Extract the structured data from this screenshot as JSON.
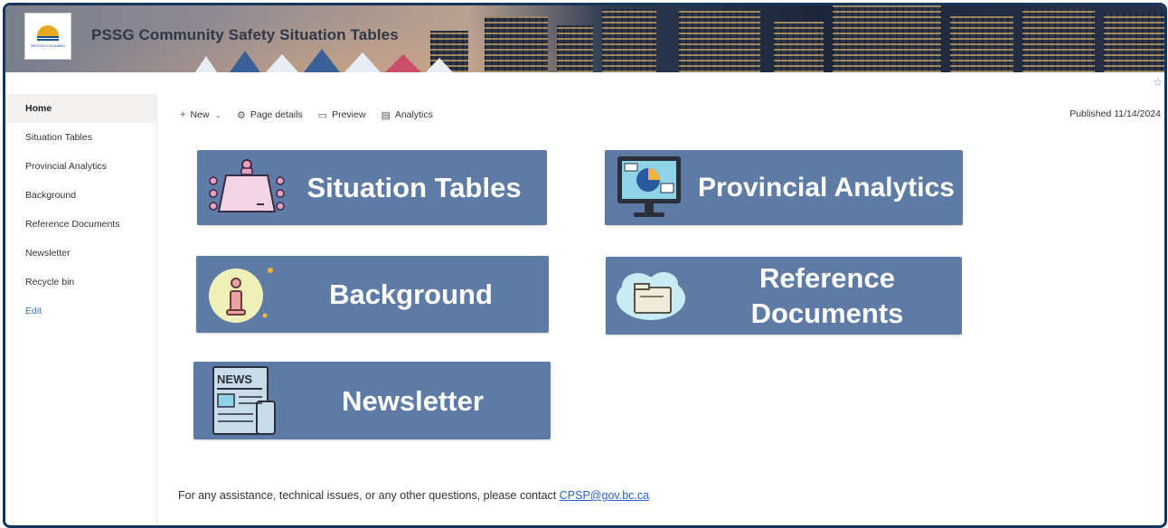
{
  "site": {
    "title": "PSSG Community Safety Situation Tables",
    "logo_text": "BRITISH COLUMBIA"
  },
  "nav": {
    "items": [
      {
        "label": "Home",
        "active": true
      },
      {
        "label": "Situation Tables"
      },
      {
        "label": "Provincial Analytics"
      },
      {
        "label": "Background"
      },
      {
        "label": "Reference Documents"
      },
      {
        "label": "Newsletter"
      },
      {
        "label": "Recycle bin"
      }
    ],
    "edit_label": "Edit"
  },
  "commandbar": {
    "new_label": "New",
    "page_details_label": "Page details",
    "preview_label": "Preview",
    "analytics_label": "Analytics"
  },
  "published": "Published 11/14/2024",
  "tiles": {
    "situation_tables": {
      "label": "Situation Tables",
      "icon": "meeting-table-icon"
    },
    "provincial_analytics": {
      "label": "Provincial Analytics",
      "icon": "analytics-monitor-icon"
    },
    "background": {
      "label": "Background",
      "icon": "info-icon"
    },
    "reference_line1": "Reference",
    "reference_line2": "Documents",
    "reference_icon": "cloud-folder-icon",
    "newsletter": {
      "label": "Newsletter",
      "icon": "newspaper-icon",
      "icon_text": "NEWS"
    }
  },
  "footer": {
    "text": "For any assistance, technical issues, or any other questions, please contact ",
    "email": "CPSP@gov.bc.ca"
  },
  "colors": {
    "tile": "#5e7ba6",
    "frame": "#15355a",
    "link": "#2a62c9"
  }
}
